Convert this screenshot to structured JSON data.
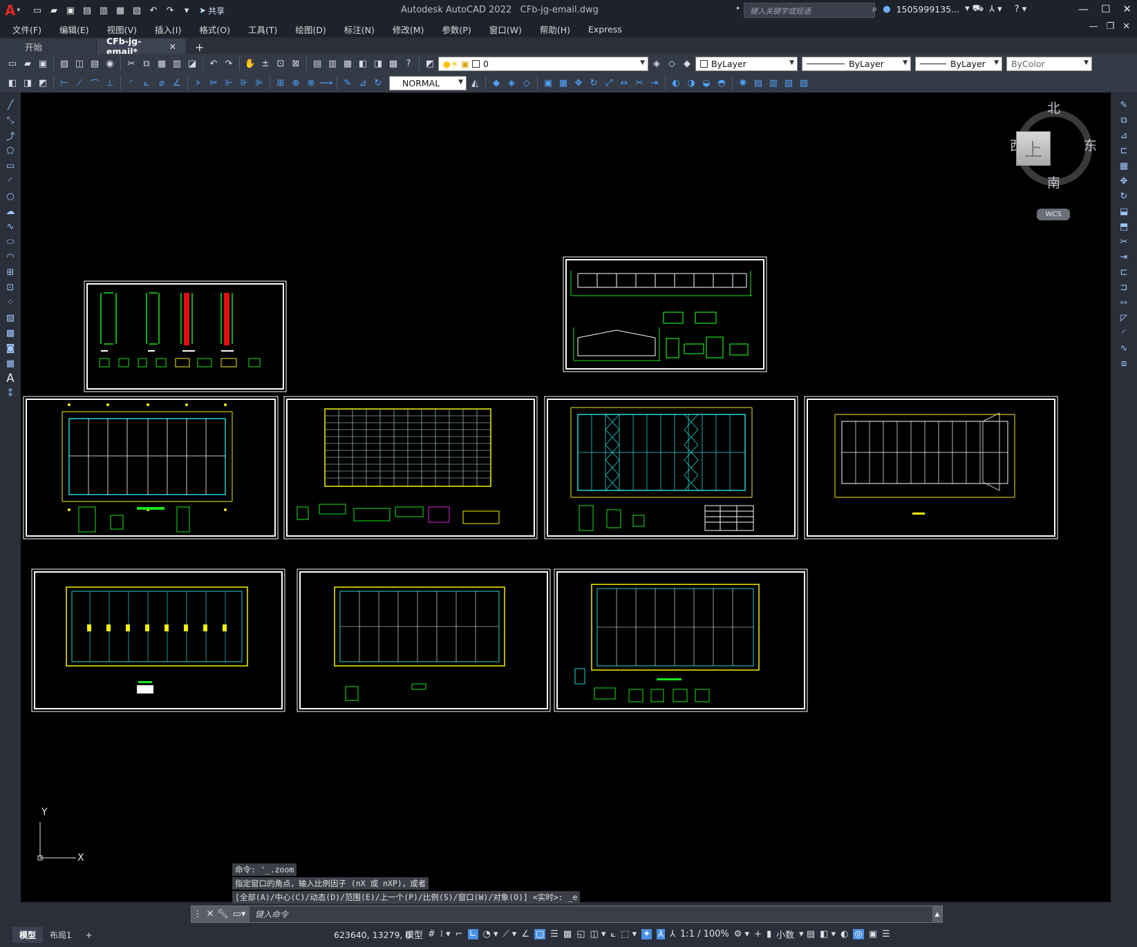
{
  "window": {
    "app_title": "Autodesk AutoCAD 2022",
    "file_title": "CFb-jg-email.dwg",
    "search_placeholder": "键入关键字或短语",
    "user": "1505999135...",
    "share_label": "共享"
  },
  "menu": [
    "文件(F)",
    "编辑(E)",
    "视图(V)",
    "插入(I)",
    "格式(O)",
    "工具(T)",
    "绘图(D)",
    "标注(N)",
    "修改(M)",
    "参数(P)",
    "窗口(W)",
    "帮助(H)",
    "Express"
  ],
  "tabs": {
    "start": "开始",
    "active": "CFb-jg-email*"
  },
  "properties": {
    "layer": "0",
    "color": "ByLayer",
    "linetype": "ByLayer",
    "lineweight": "ByLayer",
    "plotstyle": "ByColor",
    "dimstyle": "NORMAL"
  },
  "viewcube": {
    "north": "北",
    "south": "南",
    "east": "东",
    "west": "西",
    "top": "上",
    "wcs": "WCS"
  },
  "ucs": {
    "y": "Y",
    "x": "X"
  },
  "command": {
    "history": [
      "命令: '_.zoom",
      "指定窗口的角点，输入比例因子 (nX 或 nXP)，或者",
      "[全部(A)/中心(C)/动态(D)/范围(E)/上一个(P)/比例(S)/窗口(W)/对象(O)] <实时>: _e"
    ],
    "placeholder": "键入命令"
  },
  "status": {
    "layout_tabs": [
      "模型",
      "布局1"
    ],
    "coords": "623640, 13279, 0",
    "model": "模型",
    "scale": "1:1 / 100%",
    "units": "小数"
  },
  "colors": {
    "canvas": "#000000",
    "frame": "#ffffff",
    "yellow": "#f2f20a",
    "cyan": "#23d4d4",
    "green": "#19e619",
    "red": "#e01010",
    "magenta": "#e020e0"
  }
}
